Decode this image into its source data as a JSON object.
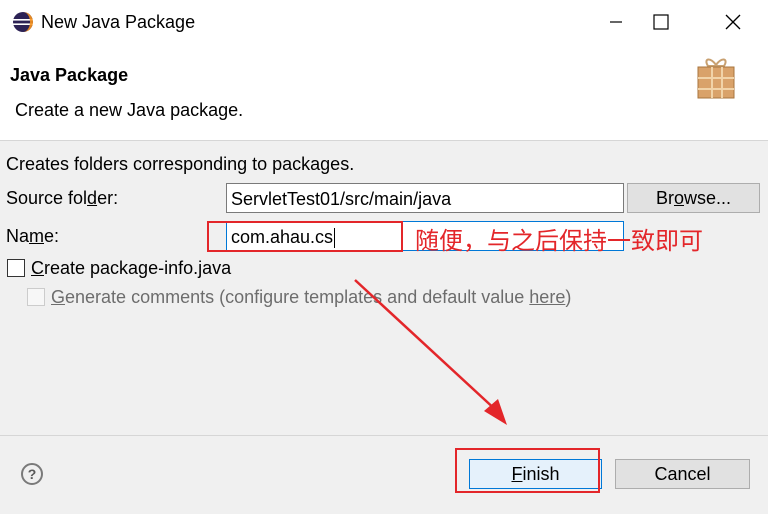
{
  "window": {
    "title": "New Java Package",
    "controls": {
      "minimize": "minimize",
      "maximize": "maximize",
      "close": "close"
    }
  },
  "header": {
    "title": "Java Package",
    "description": "Create a new Java package."
  },
  "form": {
    "info_text": "Creates folders corresponding to packages.",
    "source_folder": {
      "label_pre": "Source fol",
      "label_mnemonic": "d",
      "label_post": "er:",
      "value": "ServletTest01/src/main/java"
    },
    "browse_button": {
      "pre": "Br",
      "mnemonic": "o",
      "post": "wse..."
    },
    "name": {
      "label_pre": "Na",
      "label_mnemonic": "m",
      "label_post": "e:",
      "value": "com.ahau.cs"
    },
    "create_package_info": {
      "label_pre": "",
      "label_mnemonic": "C",
      "label_post": "reate package-info.java",
      "checked": false
    },
    "generate_comments": {
      "label_pre": "",
      "label_mnemonic": "G",
      "label_post": "enerate comments",
      "label_suffix": " (configure templates and default value ",
      "link": "here",
      "label_end": ")",
      "checked": false,
      "enabled": false
    }
  },
  "annotation": {
    "text": "随便，与之后保持一致即可",
    "color": "#e3262a"
  },
  "footer": {
    "finish_button": {
      "pre": "",
      "mnemonic": "F",
      "post": "inish"
    },
    "cancel_button": "Cancel",
    "help_icon": "?"
  },
  "colors": {
    "accent_blue": "#0078d7",
    "annotation_red": "#e3262a"
  }
}
